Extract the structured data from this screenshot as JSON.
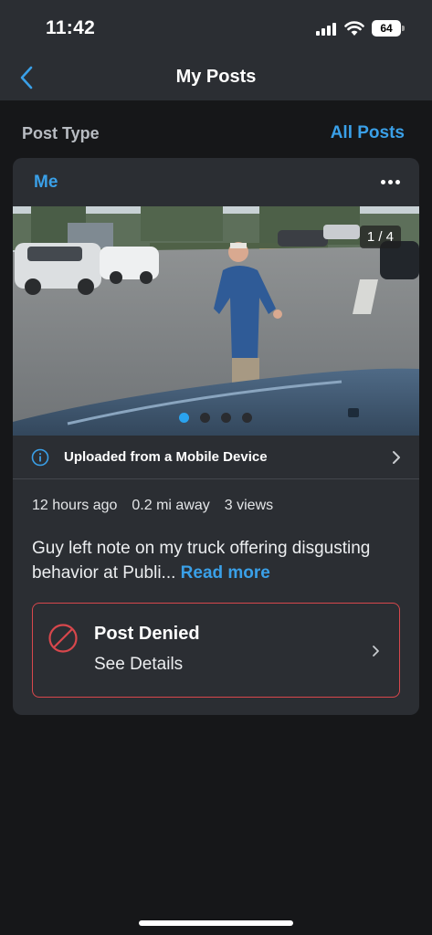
{
  "status_bar": {
    "time": "11:42",
    "battery": "64"
  },
  "nav": {
    "title": "My Posts",
    "back_icon": "chevron-left-icon"
  },
  "filter": {
    "label": "Post Type",
    "link": "All Posts"
  },
  "post": {
    "author": "Me",
    "more_icon": "ellipsis-icon",
    "media_counter": "1 / 4",
    "media_total": 4,
    "media_active_index": 0,
    "upload_source": "Uploaded from a Mobile Device",
    "time_ago": "12 hours ago",
    "distance": "0.2 mi away",
    "views": "3 views",
    "body": "Guy left note on my truck offering disgusting behavior at Publi...",
    "read_more": "Read more",
    "status": {
      "title": "Post Denied",
      "subtitle": "See Details",
      "icon": "prohibited-icon"
    }
  },
  "colors": {
    "accent": "#3aa0e8",
    "denied": "#d8474c",
    "background": "#161719",
    "card": "#2b2e33"
  }
}
